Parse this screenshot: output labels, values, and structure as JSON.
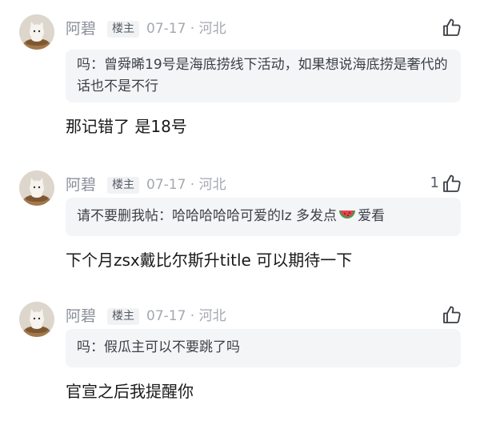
{
  "comments": [
    {
      "author": "阿碧",
      "badge": "楼主",
      "meta": "07-17 · 河北",
      "likes": "",
      "quote_author": "吗：",
      "quote_text": "曾舜晞19号是海底捞线下活动，如果想说海底捞是奢代的话也不是不行",
      "quote_tail": "",
      "reply": "那记错了 是18号"
    },
    {
      "author": "阿碧",
      "badge": "楼主",
      "meta": "07-17 · 河北",
      "likes": "1",
      "quote_author": "请不要删我帖：",
      "quote_text": "哈哈哈哈哈可爱的lz 多发点",
      "quote_tail": "爱看",
      "reply": "下个月zsx戴比尔斯升title 可以期待一下"
    },
    {
      "author": "阿碧",
      "badge": "楼主",
      "meta": "07-17 · 河北",
      "likes": "",
      "quote_author": "吗：",
      "quote_text": "假瓜主可以不要跳了吗",
      "quote_tail": "",
      "reply": "官宣之后我提醒你"
    }
  ],
  "icons": {
    "like": "thumbs-up-icon",
    "emoji": "watermelon-icon",
    "avatar": "cat-avatar"
  },
  "colors": {
    "meta": "#a4a8b0",
    "quote_bg": "#f4f5f7",
    "badge_bg": "#f1f2f4"
  }
}
